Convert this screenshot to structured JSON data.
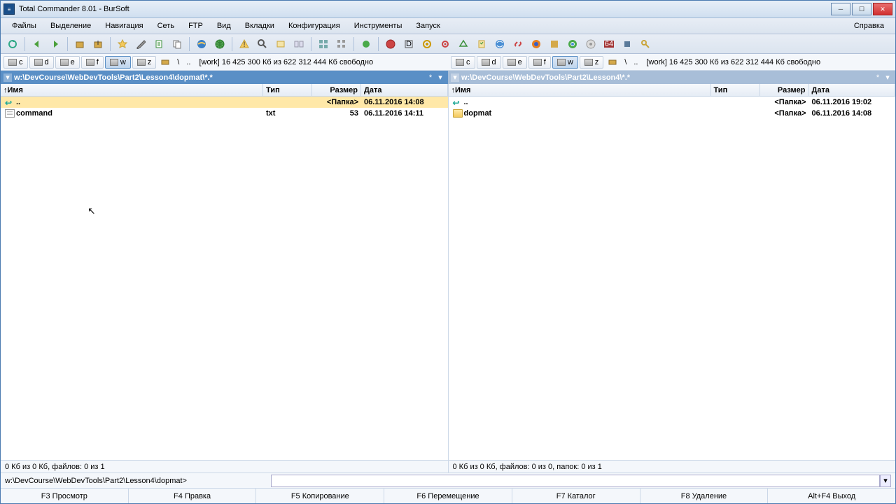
{
  "title": "Total Commander 8.01 - BurSoft",
  "menu": [
    "Файлы",
    "Выделение",
    "Навигация",
    "Сеть",
    "FTP",
    "Вид",
    "Вкладки",
    "Конфигурация",
    "Инструменты",
    "Запуск"
  ],
  "menu_help": "Справка",
  "drives": {
    "items": [
      "c",
      "d",
      "e",
      "f",
      "w",
      "z"
    ],
    "active": "w",
    "status": "[work]  16 425 300 Кб из 622 312 444 Кб свободно"
  },
  "left": {
    "path": "w:\\DevCourse\\WebDevTools\\Part2\\Lesson4\\dopmat\\*.*",
    "cols": {
      "name": "Имя",
      "type": "Тип",
      "size": "Размер",
      "date": "Дата"
    },
    "rows": [
      {
        "icon": "up",
        "name": "..",
        "type": "",
        "size": "<Папка>",
        "date": "06.11.2016 14:08",
        "selected": true
      },
      {
        "icon": "file",
        "name": "command",
        "type": "txt",
        "size": "53",
        "date": "06.11.2016 14:11"
      }
    ],
    "status": "0 Кб из 0 Кб, файлов: 0 из 1"
  },
  "right": {
    "path": "w:\\DevCourse\\WebDevTools\\Part2\\Lesson4\\*.*",
    "cols": {
      "name": "Имя",
      "type": "Тип",
      "size": "Размер",
      "date": "Дата"
    },
    "rows": [
      {
        "icon": "up",
        "name": "..",
        "type": "",
        "size": "<Папка>",
        "date": "06.11.2016 19:02"
      },
      {
        "icon": "folder",
        "name": "dopmat",
        "type": "",
        "size": "<Папка>",
        "date": "06.11.2016 14:08"
      }
    ],
    "status": "0 Кб из 0 Кб, файлов: 0 из 0, папок: 0 из 1"
  },
  "cmd_prompt": "w:\\DevCourse\\WebDevTools\\Part2\\Lesson4\\dopmat>",
  "fkeys": [
    "F3 Просмотр",
    "F4 Правка",
    "F5 Копирование",
    "F6 Перемещение",
    "F7 Каталог",
    "F8 Удаление",
    "Alt+F4 Выход"
  ]
}
